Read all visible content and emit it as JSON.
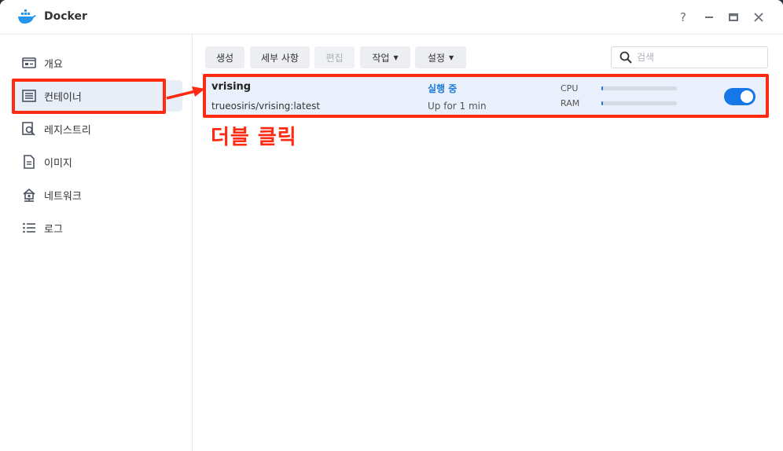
{
  "window": {
    "title": "Docker",
    "controls": {
      "help": "?",
      "minimize": "—",
      "maximize": "▭",
      "close": "✕"
    }
  },
  "sidebar": {
    "items": [
      {
        "label": "개요",
        "icon": "overview-icon"
      },
      {
        "label": "컨테이너",
        "icon": "container-list-icon",
        "active": true
      },
      {
        "label": "레지스트리",
        "icon": "registry-search-icon"
      },
      {
        "label": "이미지",
        "icon": "image-icon"
      },
      {
        "label": "네트워크",
        "icon": "network-icon"
      },
      {
        "label": "로그",
        "icon": "log-list-icon"
      }
    ]
  },
  "toolbar": {
    "create": "생성",
    "details": "세부 사항",
    "edit": "편집",
    "action": "작업",
    "settings": "설정"
  },
  "search": {
    "placeholder": "검색"
  },
  "containers": [
    {
      "name": "vrising",
      "image": "trueosiris/vrising:latest",
      "status": "실행 중",
      "uptime": "Up for 1 min",
      "cpu_label": "CPU",
      "ram_label": "RAM",
      "cpu_percent": 1,
      "ram_percent": 1,
      "enabled": true
    }
  ],
  "annotation": {
    "text": "더블 클릭"
  },
  "colors": {
    "accent": "#1d7ad8",
    "toggle_on": "#1677e6",
    "highlight": "#ff2a12",
    "row_selected": "#e9f0fb"
  }
}
